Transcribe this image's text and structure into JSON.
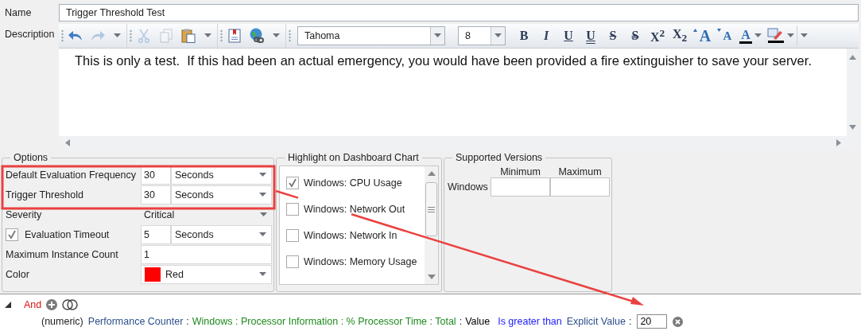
{
  "name_field": {
    "label": "Name",
    "value": "Trigger Threshold Test"
  },
  "description": {
    "label": "Description",
    "text": "This is only a test.  If this had been an actual emergency, you would have been provided a fire extinguisher to save your server."
  },
  "toolbar": {
    "groups": [
      {
        "buttons": [
          {
            "kind": "undo",
            "disabled": false
          },
          {
            "kind": "redo",
            "disabled": true
          },
          {
            "kind": "more"
          }
        ]
      },
      {
        "buttons": [
          {
            "kind": "cut",
            "disabled": true
          },
          {
            "kind": "copy",
            "disabled": true
          },
          {
            "kind": "paste",
            "disabled": false
          },
          {
            "kind": "more"
          }
        ]
      },
      {
        "buttons": [
          {
            "kind": "bookmark",
            "disabled": false
          },
          {
            "kind": "hyperlink",
            "disabled": false
          },
          {
            "kind": "more"
          }
        ]
      }
    ],
    "font": "Tahoma",
    "size": "8",
    "format": [
      {
        "kind": "bold",
        "glyph": "B"
      },
      {
        "kind": "italic",
        "glyph": "I"
      },
      {
        "kind": "underline",
        "glyph": "U"
      },
      {
        "kind": "double-underline",
        "glyph": "U"
      },
      {
        "kind": "strike",
        "glyph": "S"
      },
      {
        "kind": "double-strike",
        "glyph": "S"
      },
      {
        "kind": "superscript",
        "glyph": "X$^{2}$"
      },
      {
        "kind": "subscript",
        "glyph": "X$_{2}$"
      },
      {
        "kind": "grow",
        "glyph": "A"
      },
      {
        "kind": "shrink",
        "glyph": "A"
      },
      {
        "kind": "font-color",
        "glyph": "A"
      },
      {
        "kind": "highlight"
      }
    ]
  },
  "options": {
    "title": "Options",
    "rows": [
      {
        "kind": "number_unit",
        "label": "Default Evaluation Frequency",
        "value": "30",
        "unit": "Seconds"
      },
      {
        "kind": "number_unit",
        "label": "Trigger Threshold",
        "value": "30",
        "unit": "Seconds"
      },
      {
        "kind": "select",
        "label": "Severity",
        "value": "Critical"
      },
      {
        "kind": "check_number_unit",
        "label": "Evaluation Timeout",
        "checked": true,
        "value": "5",
        "unit": "Seconds"
      },
      {
        "kind": "text",
        "label": "Maximum Instance Count",
        "value": "1"
      },
      {
        "kind": "color",
        "label": "Color",
        "value": "Red",
        "color": "#ff0000"
      }
    ]
  },
  "highlight": {
    "title": "Highlight on Dashboard Chart",
    "items": [
      {
        "label": "Windows: CPU Usage",
        "checked": true
      },
      {
        "label": "Windows: Network Out",
        "checked": false
      },
      {
        "label": "Windows: Network In",
        "checked": false
      },
      {
        "label": "Windows: Memory Usage",
        "checked": false
      }
    ]
  },
  "versions": {
    "title": "Supported Versions",
    "columns": [
      "Minimum",
      "Maximum"
    ],
    "rows": [
      {
        "label": "Windows"
      }
    ]
  },
  "conditions": {
    "expanded": true,
    "operator": "And",
    "items": [
      {
        "tokens": [
          {
            "kind": "type",
            "text": "(numeric)"
          },
          {
            "kind": "source",
            "text": "Performance Counter"
          },
          {
            "kind": "separator",
            "text": ":"
          },
          {
            "kind": "path",
            "text": "Windows : Processor Information : % Processor Time : Total"
          },
          {
            "kind": "separator",
            "text": ":"
          },
          {
            "kind": "field",
            "text": "Value"
          },
          {
            "kind": "operator",
            "text": "Is greater than"
          },
          {
            "kind": "source",
            "text": "Explicit Value"
          },
          {
            "kind": "separator",
            "text": ":"
          },
          {
            "kind": "input",
            "text": "20"
          }
        ]
      }
    ]
  }
}
